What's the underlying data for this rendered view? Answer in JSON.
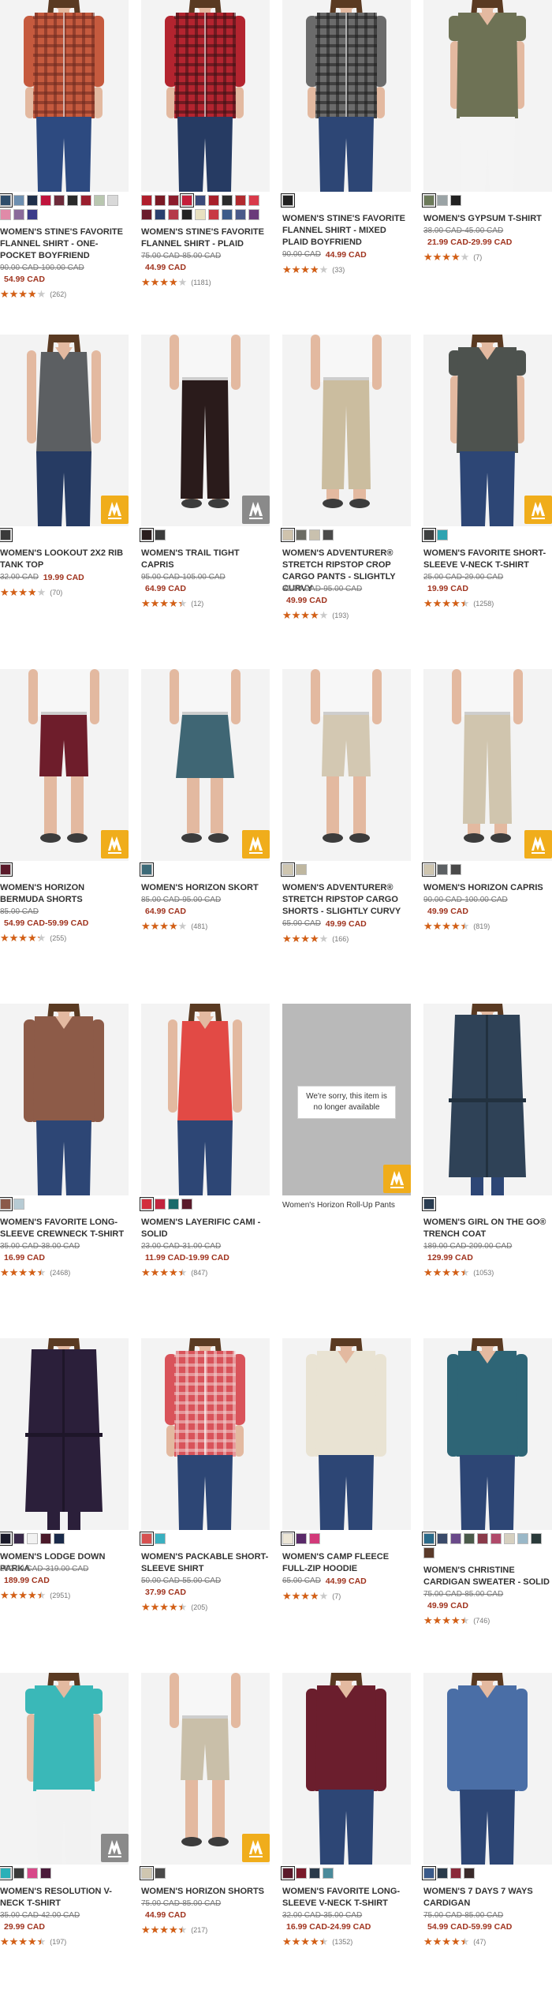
{
  "products": [
    {
      "name": "WOMEN'S STINE'S FAVORITE FLANNEL SHIRT - ONE-POCKET BOYFRIEND",
      "orig": "90.00 CAD-100.00 CAD",
      "sale": "54.99 CAD",
      "rating": 3.9,
      "reviews": "(262)",
      "swatches": [
        "#2e4d6b",
        "#6d8fb0",
        "#1f2f4a",
        "#c0143c",
        "#6d2a3a",
        "#2a2a2a",
        "#9a1e2e",
        "#b9c7b0",
        "#d9d9d9",
        "#e08aa8",
        "#8a6a9a",
        "#3b3b8a"
      ],
      "selected": 0,
      "shirt": "#c55a3e",
      "shirt2": "#6b2a1f",
      "pants": "#2d4a80",
      "plaid": true
    },
    {
      "name": "WOMEN'S STINE'S FAVORITE FLANNEL SHIRT - PLAID",
      "orig": "75.00 CAD-85.00 CAD",
      "sale": "44.99 CAD",
      "rating": 4.0,
      "reviews": "(1181)",
      "swatches": [
        "#b01e2c",
        "#7a1a24",
        "#8c1c2c",
        "#c41e3a",
        "#3b4a7a",
        "#a81f2a",
        "#2c2c2c",
        "#b22a2e",
        "#d93a4a",
        "#6a1b2b",
        "#2a3f6e",
        "#b5394a",
        "#222",
        "#e8e0c0",
        "#c83844",
        "#3d5c8a",
        "#4a5a8a",
        "#6a3a7a"
      ],
      "selected": 3,
      "shirt": "#b3242f",
      "shirt2": "#3a1216",
      "pants": "#263b63",
      "plaid": true
    },
    {
      "name": "WOMEN'S STINE'S FAVORITE FLANNEL SHIRT - MIXED PLAID BOYFRIEND",
      "orig": "90.00 CAD",
      "sale": "44.99 CAD",
      "saleInline": true,
      "rating": 3.9,
      "reviews": "(33)",
      "swatches": [
        "#222222"
      ],
      "selected": 0,
      "shirt": "#6b6b6b",
      "shirt2": "#1e1e1e",
      "pants": "#2d4675",
      "plaid": true
    },
    {
      "name": "WOMEN'S GYPSUM T-SHIRT",
      "orig": "38.00 CAD-45.00 CAD",
      "sale": "21.99 CAD-29.99 CAD",
      "rating": 4.0,
      "reviews": "(7)",
      "swatches": [
        "#6c7a5a",
        "#9aa3a5",
        "#222222"
      ],
      "selected": 0,
      "shirt": "#6e7255",
      "shirt2": "#5a5e44",
      "pants": "#f4f4f4",
      "plaid": false
    },
    {
      "name": "WOMEN'S LOOKOUT 2X2 RIB TANK TOP",
      "orig": "32.00 CAD",
      "sale": "19.99 CAD",
      "saleInline": true,
      "rating": 3.9,
      "reviews": "(70)",
      "swatches": [
        "#3a3a3a"
      ],
      "selected": 0,
      "shirt": "#5c5f62",
      "shirt2": "#4a4c50",
      "pants": "#263b63",
      "tank": true,
      "badge": "trekker"
    },
    {
      "name": "WOMEN'S TRAIL TIGHT CAPRIS",
      "orig": "95.00 CAD-105.00 CAD",
      "sale": "64.99 CAD",
      "rating": 4.4,
      "reviews": "(12)",
      "swatches": [
        "#2b1d1d",
        "#3c3c3c"
      ],
      "selected": 0,
      "shirt": "#f2f2f2",
      "shirt2": "#f2f2f2",
      "pants": "#2a1b1b",
      "capri": true,
      "badge": "motion"
    },
    {
      "name": "WOMEN'S ADVENTURER® STRETCH RIPSTOP CROP CARGO PANTS - SLIGHTLY CURVY",
      "orig": "85.00 CAD-95.00 CAD",
      "sale": "49.99 CAD",
      "rating": 4.0,
      "reviews": "(193)",
      "swatches": [
        "#cfc3ad",
        "#6b6b64",
        "#c9c1ae",
        "#4a4a4a"
      ],
      "selected": 0,
      "shirt": "#f2f2f2",
      "shirt2": "#f2f2f2",
      "pants": "#cbbd9f",
      "crop": true
    },
    {
      "name": "WOMEN'S FAVORITE SHORT-SLEEVE V-NECK T-SHIRT",
      "orig": "25.00 CAD-29.00 CAD",
      "sale": "19.99 CAD",
      "rating": 4.5,
      "reviews": "(1258)",
      "swatches": [
        "#3d4040",
        "#2ea3b0"
      ],
      "selected": 0,
      "shirt": "#4d524e",
      "shirt2": "#3e423f",
      "pants": "#2d4675",
      "badge": "trekker"
    },
    {
      "name": "WOMEN'S HORIZON BERMUDA SHORTS",
      "orig": "85.00 CAD",
      "sale": "54.99 CAD-59.99 CAD",
      "rating": 4.3,
      "reviews": "(255)",
      "swatches": [
        "#5a1a2a"
      ],
      "selected": 0,
      "shirt": "#f2f2f2",
      "shirt2": "#f2f2f2",
      "pants": "#6e1d2b",
      "shorts": true,
      "badge": "trekker"
    },
    {
      "name": "WOMEN'S HORIZON SKORT",
      "orig": "85.00 CAD-95.00 CAD",
      "sale": "64.99 CAD",
      "rating": 4.0,
      "reviews": "(481)",
      "swatches": [
        "#3c6a78"
      ],
      "selected": 0,
      "shirt": "#f2f2f2",
      "shirt2": "#f2f2f2",
      "pants": "#3f6674",
      "skort": true,
      "badge": "trekker"
    },
    {
      "name": "WOMEN'S ADVENTURER® STRETCH RIPSTOP CARGO SHORTS - SLIGHTLY CURVY",
      "orig": "65.00 CAD",
      "sale": "49.99 CAD",
      "saleInline": true,
      "rating": 4.0,
      "reviews": "(166)",
      "swatches": [
        "#cfc6b0",
        "#bfb7a0"
      ],
      "selected": 0,
      "shirt": "#f2f2f2",
      "shirt2": "#f2f2f2",
      "pants": "#d3c8b2",
      "shorts": true
    },
    {
      "name": "WOMEN'S HORIZON CAPRIS",
      "orig": "90.00 CAD-100.00 CAD",
      "sale": "49.99 CAD",
      "rating": 4.5,
      "reviews": "(819)",
      "swatches": [
        "#cfc6b0",
        "#5c6063",
        "#4a4a4a"
      ],
      "selected": 0,
      "shirt": "#f2f2f2",
      "shirt2": "#f2f2f2",
      "pants": "#d0c5ae",
      "crop": true,
      "badge": "trekker"
    },
    {
      "name": "WOMEN'S FAVORITE LONG-SLEEVE CREWNECK T-SHIRT",
      "orig": "35.00 CAD-38.00 CAD",
      "sale": "16.99 CAD",
      "rating": 4.5,
      "reviews": "(2468)",
      "swatches": [
        "#8b5a4a",
        "#b7cbd4"
      ],
      "selected": 0,
      "shirt": "#8d5b48",
      "shirt2": "#7a4b3a",
      "pants": "#2d4675",
      "longsleeve": true
    },
    {
      "name": "WOMEN'S LAYERIFIC CAMI - SOLID",
      "orig": "23.00 CAD-31.00 CAD",
      "sale": "11.99 CAD-19.99 CAD",
      "rating": 4.5,
      "reviews": "(847)",
      "swatches": [
        "#d32e3c",
        "#c2243e",
        "#1a6a6a",
        "#5a1a2a"
      ],
      "selected": 0,
      "shirt": "#e24a45",
      "shirt2": "#c7362f",
      "pants": "#2d4675",
      "tank": true
    },
    {
      "unavailable": true,
      "message": "We're sorry, this item is no longer available",
      "name": "Women's Horizon Roll-Up Pants",
      "badge": "trekker"
    },
    {
      "name": "WOMEN'S GIRL ON THE GO® TRENCH COAT",
      "orig": "189.00 CAD-209.00 CAD",
      "sale": "129.99 CAD",
      "rating": 4.5,
      "reviews": "(1053)",
      "swatches": [
        "#2a3d52"
      ],
      "selected": 0,
      "shirt": "#2f4257",
      "shirt2": "#22313f",
      "pants": "#2d4675",
      "coat": true
    },
    {
      "name": "WOMEN'S LODGE DOWN PARKA",
      "orig": "289.00 CAD-319.00 CAD",
      "sale": "189.99 CAD",
      "rating": 4.5,
      "reviews": "(2951)",
      "swatches": [
        "#1a1a2a",
        "#3a2a4a",
        "#f2f2f2",
        "#4a1a2a",
        "#1a2a4a"
      ],
      "selected": 0,
      "shirt": "#2b1f3a",
      "shirt2": "#1e1629",
      "pants": "#2b1f3a",
      "coat": true
    },
    {
      "name": "WOMEN'S PACKABLE SHORT-SLEEVE SHIRT",
      "orig": "50.00 CAD-55.00 CAD",
      "sale": "37.99 CAD",
      "rating": 4.5,
      "reviews": "(205)",
      "swatches": [
        "#d65050",
        "#3ab0c0"
      ],
      "selected": 0,
      "shirt": "#d9535a",
      "shirt2": "#f1d0d0",
      "pants": "#2d4675",
      "plaid": true
    },
    {
      "name": "WOMEN'S CAMP FLEECE FULL-ZIP HOODIE",
      "orig": "65.00 CAD",
      "sale": "44.99 CAD",
      "saleInline": true,
      "rating": 3.9,
      "reviews": "(7)",
      "swatches": [
        "#ece6d6",
        "#5a2a6a",
        "#d23a7a"
      ],
      "selected": 0,
      "shirt": "#e9e3d3",
      "shirt2": "#d8d0bc",
      "pants": "#2d4675",
      "longsleeve": true
    },
    {
      "name": "WOMEN'S CHRISTINE CARDIGAN SWEATER - SOLID",
      "orig": "75.00 CAD-85.00 CAD",
      "sale": "49.99 CAD",
      "rating": 4.5,
      "reviews": "(746)",
      "swatches": [
        "#2a6a8a",
        "#3a4a6a",
        "#6a4a8a",
        "#4a5a4a",
        "#8a3a4a",
        "#b04a6a",
        "#d6d0c0",
        "#9ab8c8",
        "#2a3a3a",
        "#5a3a2a"
      ],
      "selected": 0,
      "shirt": "#2e6576",
      "shirt2": "#245463",
      "pants": "#2d4675",
      "longsleeve": true
    },
    {
      "name": "WOMEN'S RESOLUTION V-NECK T-SHIRT",
      "orig": "35.00 CAD-42.00 CAD",
      "sale": "29.99 CAD",
      "rating": 4.5,
      "reviews": "(197)",
      "swatches": [
        "#2ab0b8",
        "#3a3a3a",
        "#d84a8a",
        "#4a1a3a"
      ],
      "selected": 0,
      "shirt": "#3ab8b8",
      "shirt2": "#2b9c9d",
      "pants": "#f2f2f2",
      "badge": "motion"
    },
    {
      "name": "WOMEN'S HORIZON SHORTS",
      "orig": "75.00 CAD-85.00 CAD",
      "sale": "44.99 CAD",
      "rating": 4.5,
      "reviews": "(217)",
      "swatches": [
        "#cfc6b0",
        "#4a4a4a"
      ],
      "selected": 0,
      "shirt": "#f2f2f2",
      "shirt2": "#f2f2f2",
      "pants": "#c9bfa9",
      "shorts": true,
      "badge": "trekker"
    },
    {
      "name": "WOMEN'S FAVORITE LONG-SLEEVE V-NECK T-SHIRT",
      "orig": "32.00 CAD-35.00 CAD",
      "sale": "16.99 CAD-24.99 CAD",
      "rating": 4.5,
      "reviews": "(1352)",
      "swatches": [
        "#5a1a2a",
        "#7a1a2a",
        "#2a3a4a",
        "#4a8a9a"
      ],
      "selected": 0,
      "shirt": "#6b1e2d",
      "shirt2": "#571625",
      "pants": "#2d4675",
      "longsleeve": true
    },
    {
      "name": "WOMEN'S 7 DAYS 7 WAYS CARDIGAN",
      "orig": "75.00 CAD-85.00 CAD",
      "sale": "54.99 CAD-59.99 CAD",
      "rating": 4.5,
      "reviews": "(47)",
      "swatches": [
        "#3a5a8a",
        "#2a3a4a",
        "#8a2a3a",
        "#3a2a2a"
      ],
      "selected": 0,
      "shirt": "#4a6ea6",
      "shirt2": "#f0f0f0",
      "pants": "#2d4675",
      "longsleeve": true
    }
  ]
}
